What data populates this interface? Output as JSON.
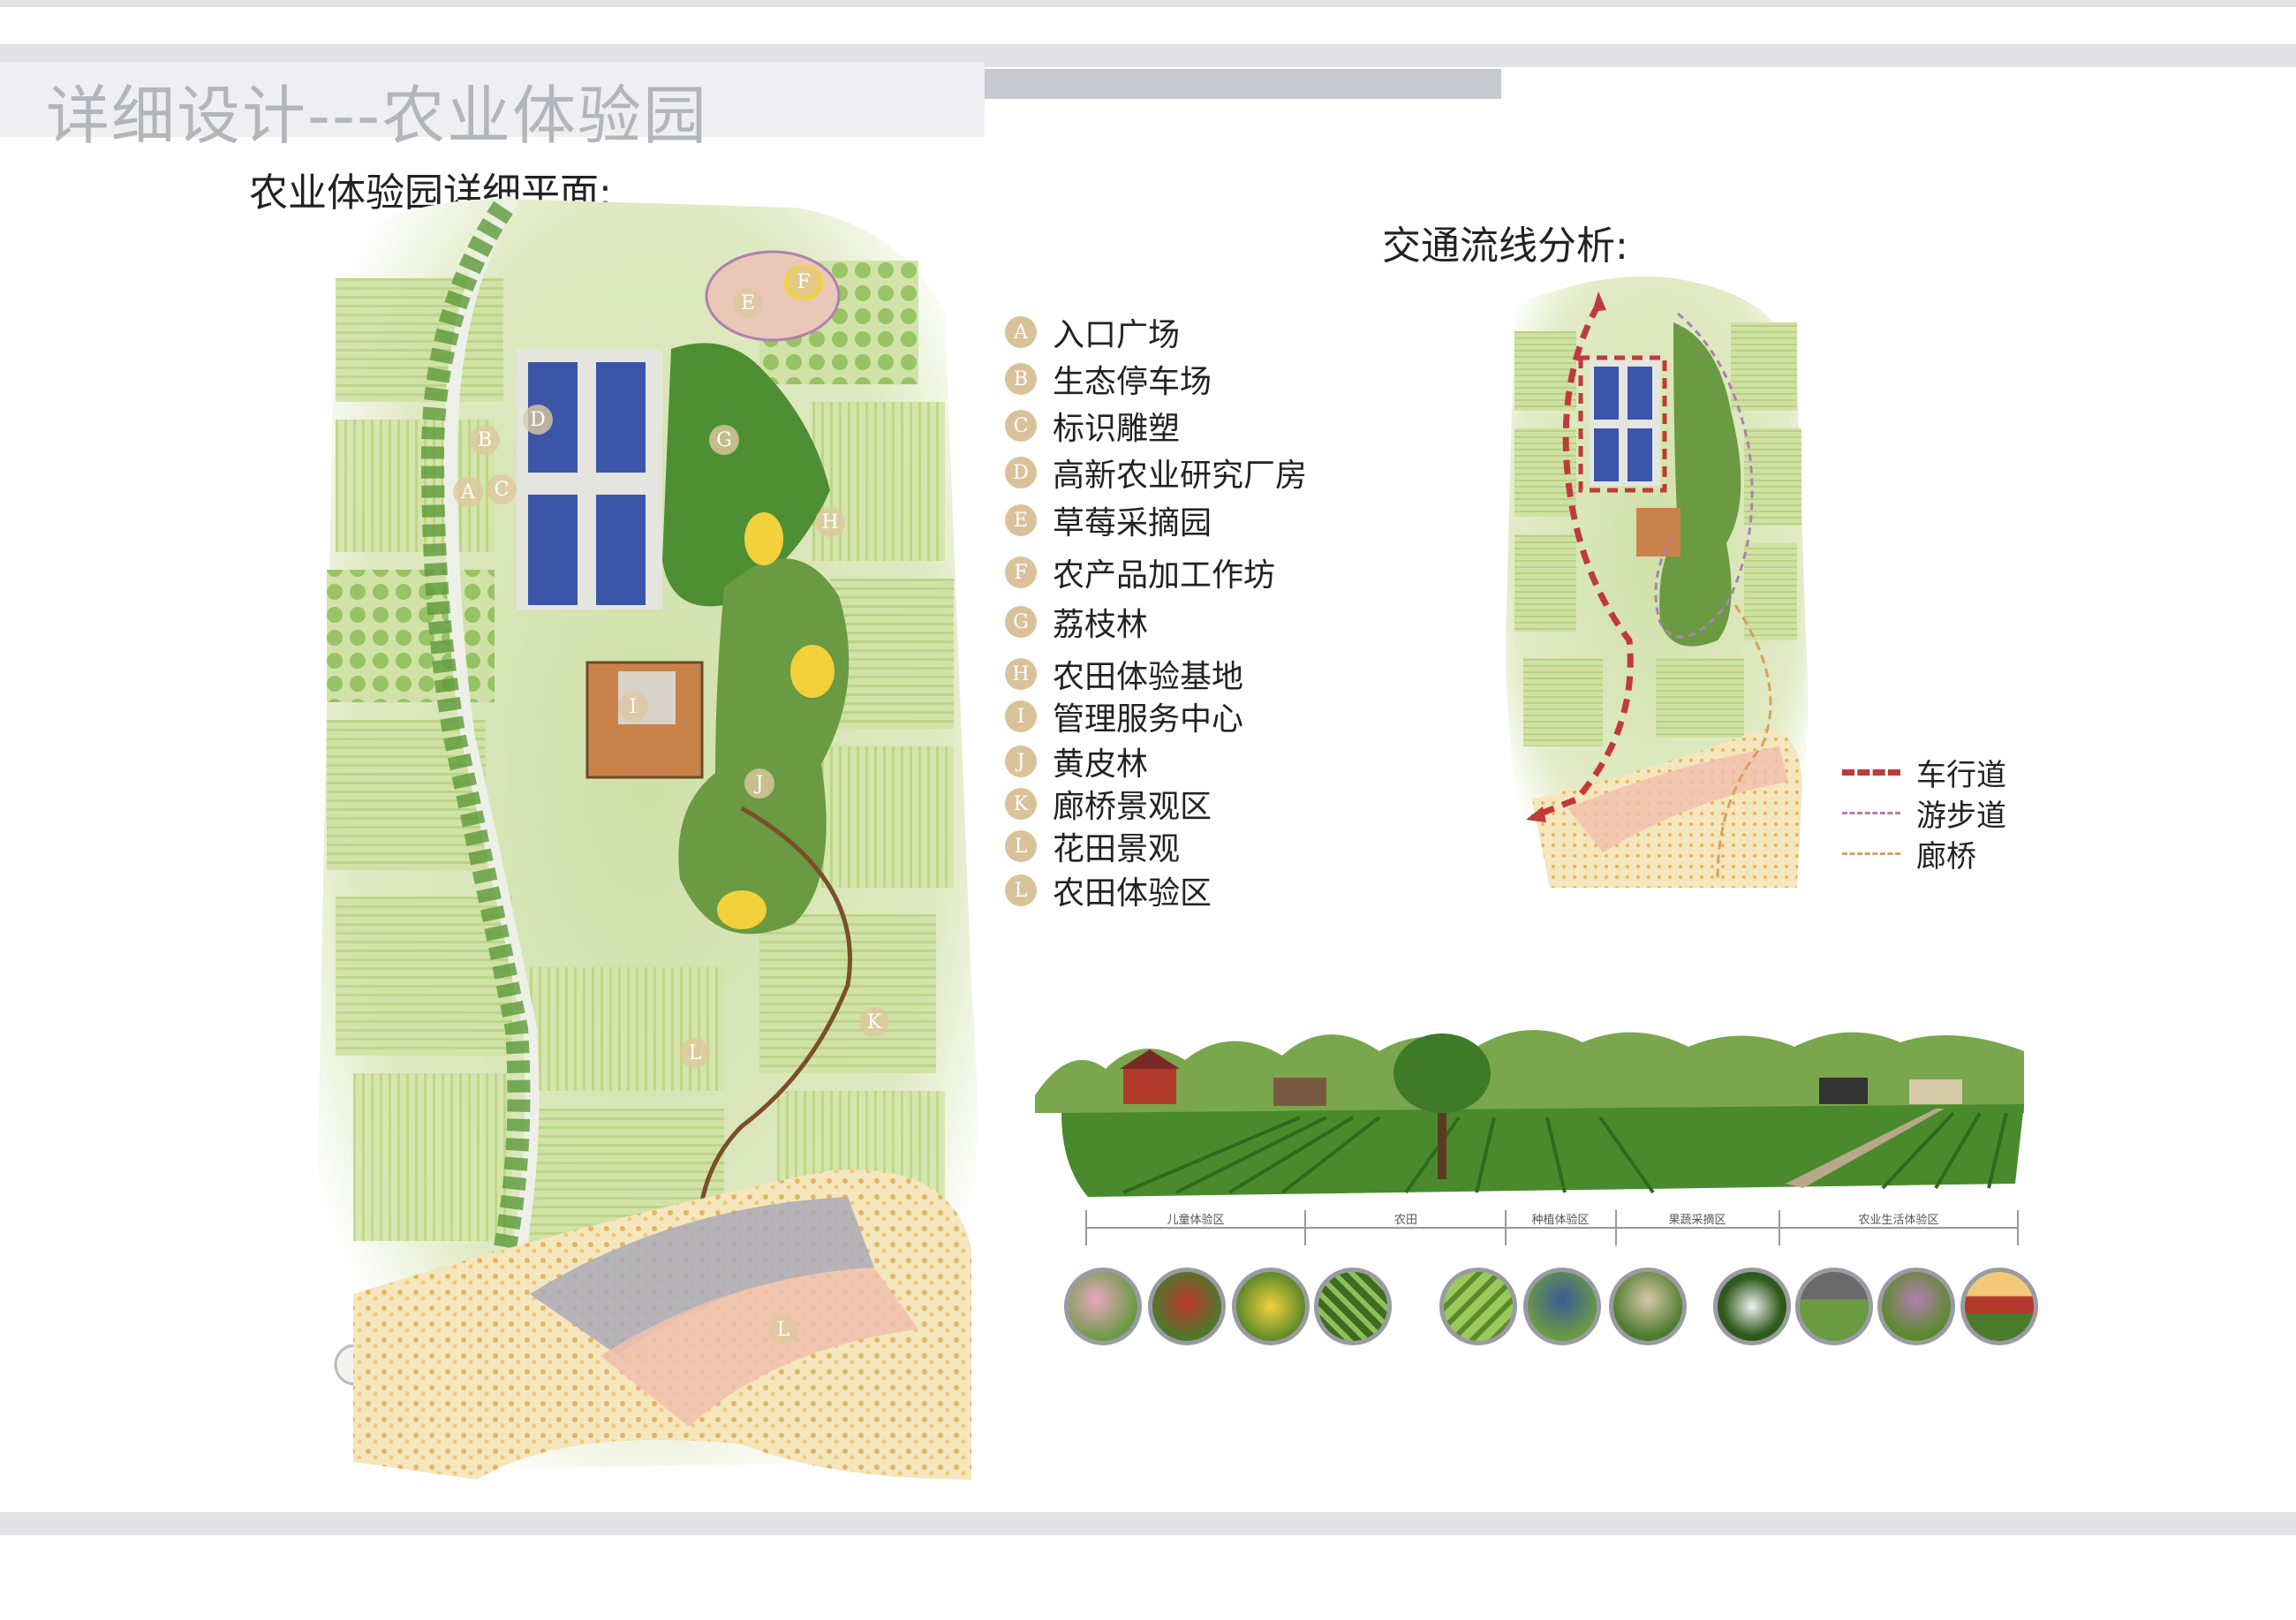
{
  "page_title": "详细设计---农业体验园",
  "plan_heading": "农业体验园详细平面:",
  "flow_heading": "交通流线分析:",
  "legend": [
    {
      "letter": "A",
      "label": "入口广场"
    },
    {
      "letter": "B",
      "label": "生态停车场"
    },
    {
      "letter": "C",
      "label": "标识雕塑"
    },
    {
      "letter": "D",
      "label": "高新农业研究厂房"
    },
    {
      "letter": "E",
      "label": "草莓采摘园"
    },
    {
      "letter": "F",
      "label": "农产品加工作坊"
    },
    {
      "letter": "G",
      "label": "荔枝林"
    },
    {
      "letter": "H",
      "label": "农田体验基地"
    },
    {
      "letter": "I",
      "label": "管理服务中心"
    },
    {
      "letter": "J",
      "label": "黄皮林"
    },
    {
      "letter": "K",
      "label": "廊桥景观区"
    },
    {
      "letter": "L",
      "label": "花田景观"
    },
    {
      "letter": "L",
      "label": "农田体验区"
    }
  ],
  "flow_legend": [
    {
      "label": "车行道",
      "color": "#c0393b",
      "style": "dashed-thick"
    },
    {
      "label": "游步道",
      "color": "#b07fb0",
      "style": "dashed-thin"
    },
    {
      "label": "廊桥",
      "color": "#d8a060",
      "style": "dashed-thin"
    }
  ],
  "map_letters": [
    "A",
    "B",
    "C",
    "D",
    "E",
    "F",
    "G",
    "H",
    "I",
    "J",
    "K",
    "L",
    "L"
  ],
  "section_zones": [
    "儿童体验区",
    "农田",
    "种植体验区",
    "果蔬采摘区",
    "农业生活体验区"
  ],
  "photo_thumbs": [
    "children-photo",
    "farmer-photo",
    "corn-photo",
    "field-photo",
    "field-aerial-photo",
    "harvest-photo",
    "vegetable-photo",
    "cows-photo",
    "pasture-photo",
    "family-photo",
    "barn-photo"
  ],
  "colors": {
    "accent_band": "#e1e1e6",
    "badge": "#d9c29a",
    "road": "#c0393b",
    "footpath": "#b07fb0",
    "bridge": "#d8a060"
  }
}
